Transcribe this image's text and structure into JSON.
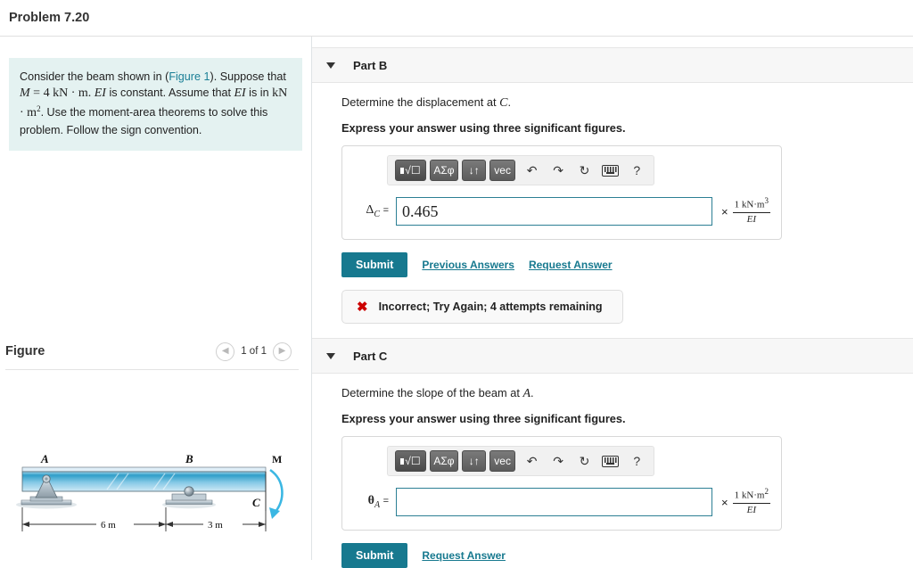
{
  "header": {
    "title": "Problem 7.20"
  },
  "statement": {
    "seg1": "Consider the beam shown in (",
    "figure_link": "Figure 1",
    "seg2": "). Suppose that ",
    "m_var": "M",
    "m_eq": " = 4 kN",
    "dot": " · ",
    "m_unit": "m.",
    "ei1": "EI",
    "seg3": " is constant. Assume that ",
    "ei2": "EI",
    "seg4": " is in ",
    "kn": "kN",
    "m2": "m",
    "m2_sup": "2",
    "seg5": ". Use the moment-area theorems to solve this problem. Follow the sign convention."
  },
  "figure": {
    "label": "Figure",
    "count": "1 of 1",
    "prev_icon": "chevron-left-icon",
    "next_icon": "chevron-right-icon",
    "labels": {
      "A": "A",
      "B": "B",
      "C": "C",
      "M": "M",
      "dim_left": "6 m",
      "dim_right": "3 m"
    }
  },
  "mathbar": {
    "template_label": "√",
    "greek_label": "ΑΣφ",
    "arrows_label": "↓↑",
    "vec_label": "vec",
    "undo_icon": "undo-icon",
    "redo_icon": "redo-icon",
    "reset_icon": "reset-icon",
    "keyboard_icon": "keyboard-icon",
    "help_label": "?"
  },
  "parts": [
    {
      "id": "B",
      "title": "Part B",
      "prompt_before": "Determine the displacement at ",
      "prompt_var": "C",
      "prompt_after": ".",
      "instruction": "Express your answer using three significant figures.",
      "var_symbol": "Δ",
      "var_sub": "C",
      "var_eq": "=",
      "value": "0.465",
      "placeholder": "",
      "unit_times": "×",
      "unit_num": "1 kN·m",
      "unit_num_sup": "3",
      "unit_den": "EI",
      "submit_label": "Submit",
      "previous_answers_label": "Previous Answers",
      "request_answer_label": "Request Answer",
      "feedback": "Incorrect; Try Again; 4 attempts remaining",
      "feedback_icon": "x-mark-icon"
    },
    {
      "id": "C",
      "title": "Part C",
      "prompt_before": "Determine the slope of the beam at ",
      "prompt_var": "A",
      "prompt_after": ".",
      "instruction": "Express your answer using three significant figures.",
      "var_symbol": "θ",
      "var_sub": "A",
      "var_eq": "=",
      "value": "",
      "placeholder": "",
      "unit_times": "×",
      "unit_num": "1 kN·m",
      "unit_num_sup": "2",
      "unit_den": "EI",
      "submit_label": "Submit",
      "request_answer_label": "Request Answer"
    }
  ],
  "colors": {
    "accent_teal": "#17798f",
    "statement_bg": "#e4f2f1",
    "error_red": "#cc0000",
    "beam_blue": "#5fb4d8"
  }
}
